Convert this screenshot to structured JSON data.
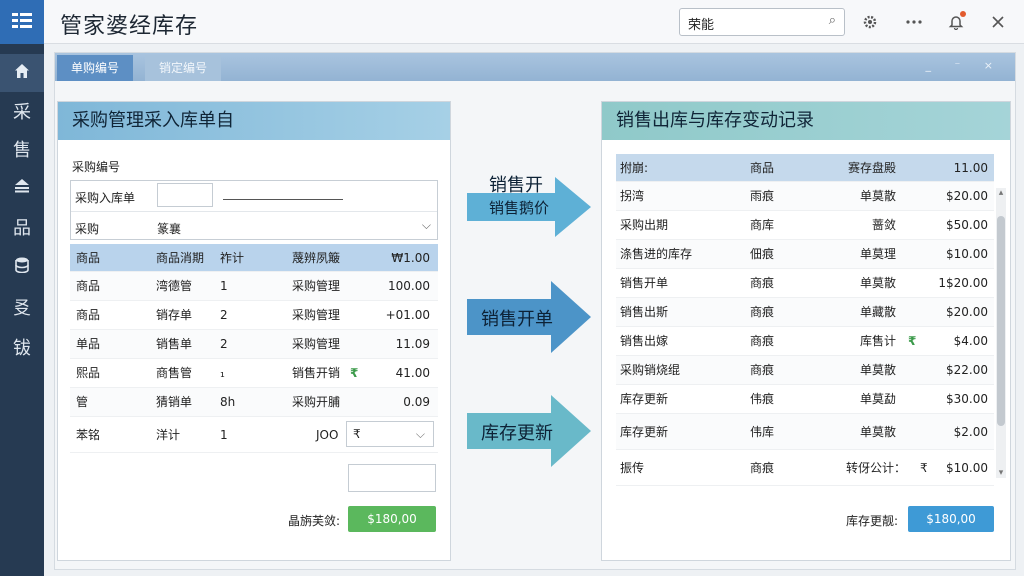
{
  "app": {
    "title": "管家婆经库存"
  },
  "search": {
    "value": "荣能",
    "icon": "search-icon"
  },
  "topbar_icons": [
    "settings-icon",
    "more-icon",
    "notification-icon",
    "close-icon"
  ],
  "sidebar": {
    "items": [
      {
        "label": "⌂",
        "icon": "home-icon"
      },
      {
        "label": "采"
      },
      {
        "label": "售"
      },
      {
        "label": "⏏",
        "icon": "warehouse-icon"
      },
      {
        "label": "品"
      },
      {
        "label": "⛁",
        "icon": "database-icon"
      },
      {
        "label": "㕛"
      },
      {
        "label": "钹"
      }
    ]
  },
  "tabs": [
    {
      "label": "单购编号"
    },
    {
      "label": "销定编号"
    }
  ],
  "window_controls": "_ ⁻ ×",
  "left_panel": {
    "title": "采购管理采入库单自",
    "field_caption": "采购编号",
    "form": {
      "row1_label": "采购入库单",
      "row2_label": "采购",
      "row2_value": "篆襄"
    },
    "table": {
      "headers": [
        "商品",
        "商品消期",
        "祚计",
        "蔑辨夙簸",
        "₩1.00"
      ],
      "rows": [
        [
          "商品",
          "湾德管",
          "1",
          "采购管理",
          "100.00"
        ],
        [
          "商品",
          "销存单",
          "2",
          "采购管理",
          "+01.00"
        ],
        [
          "单品",
          "销售单",
          "2",
          "采购管理",
          "11.09"
        ],
        [
          "熙品",
          "商售管",
          "₁",
          "销售开销",
          "41.00"
        ],
        [
          "管",
          "猜销单",
          "8h",
          "采购开脯",
          "0.09"
        ],
        [
          "苯铭",
          "洋计",
          "1",
          "JOO",
          ""
        ]
      ],
      "row4_mark": "₹",
      "select_value": "₹"
    },
    "total_label": "晶旃芙敛:",
    "total_value": "$180,00"
  },
  "flow": {
    "arrow1_title": "销售开",
    "arrow1_label": "销售鹅价",
    "arrow2_label": "销售开单",
    "arrow3_label": "库存更新"
  },
  "right_panel": {
    "title": "销售出库与库存变动记录",
    "table": {
      "headers": [
        "拊崩:",
        "商品",
        "赛存盘殿",
        "11.00"
      ],
      "rows": [
        [
          "拐湾",
          "雨痕",
          "单莫散",
          "$20.00"
        ],
        [
          "采购出期",
          "商库",
          "蔷敛",
          "$50.00"
        ],
        [
          "涤售进的库存",
          "佃痕",
          "单莫理",
          "$10.00"
        ],
        [
          "销售开单",
          "商痕",
          "单莫散",
          "1$20.00"
        ],
        [
          "销售出斯",
          "商痕",
          "单藏散",
          "$20.00"
        ],
        [
          "销售出嫁",
          "商痕",
          "库售计",
          "$4.00"
        ],
        [
          "采购销烧绲",
          "商痕",
          "单莫散",
          "$22.00"
        ],
        [
          "库存更新",
          "伟痕",
          "单莫勐",
          "$30.00"
        ],
        [
          "库存更新",
          "伟库",
          "单莫散",
          "$2.00"
        ],
        [
          "振传",
          "商痕",
          "转伢公计：",
          "$10.00"
        ]
      ],
      "row6_mark": "₹",
      "row10_mark": "₹"
    },
    "total_label": "库存更靓:",
    "total_value": "$180,00"
  },
  "colors": {
    "accent": "#2f6db5",
    "sidebar": "#263a52",
    "green_total": "#5bb85d",
    "blue_total": "#3e9ad6"
  }
}
